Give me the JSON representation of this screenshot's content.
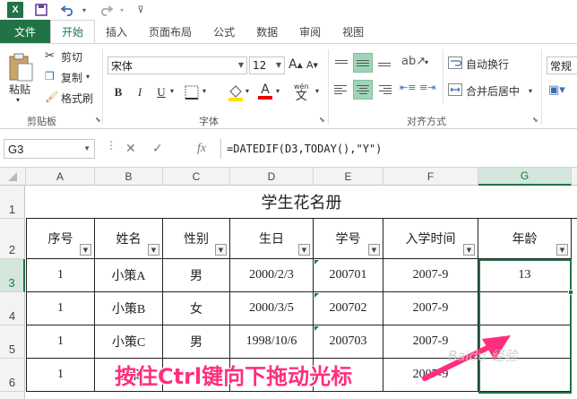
{
  "app": {
    "icon_label": "X",
    "colors": {
      "accent": "#217346",
      "select_fill": "#d3e7dc",
      "align_on": "#9fd5b7",
      "caption": "#ff2e7e",
      "arrow": "#ff2e7e"
    }
  },
  "ribbon": {
    "tabs": [
      "文件",
      "开始",
      "插入",
      "页面布局",
      "公式",
      "数据",
      "审阅",
      "视图"
    ],
    "clipboard": {
      "paste": "粘贴",
      "cut": "剪切",
      "copy": "复制",
      "format_painter": "格式刷",
      "label": "剪贴板"
    },
    "font": {
      "name": "宋体",
      "size": "12",
      "bold": "B",
      "italic": "I",
      "underline": "U",
      "wen": "wén",
      "wen_char": "文",
      "label": "字体"
    },
    "align": {
      "wrap": "自动换行",
      "merge": "合并后居中",
      "label": "对齐方式"
    },
    "number": {
      "format": "常规"
    }
  },
  "formula_bar": {
    "cell_ref": "G3",
    "fx": "fx",
    "formula": "=DATEDIF(D3,TODAY(),\"Y\")"
  },
  "grid": {
    "columns": [
      "A",
      "B",
      "C",
      "D",
      "E",
      "F",
      "G"
    ],
    "rows": [
      "1",
      "2",
      "3",
      "4",
      "5",
      "6"
    ],
    "title": "学生花名册",
    "headers": [
      "序号",
      "姓名",
      "性别",
      "生日",
      "学号",
      "入学时间",
      "年龄"
    ],
    "data": [
      [
        "1",
        "小策A",
        "男",
        "2000/2/3",
        "200701",
        "2007-9",
        "13"
      ],
      [
        "1",
        "小策B",
        "女",
        "2000/3/5",
        "200702",
        "2007-9",
        ""
      ],
      [
        "1",
        "小策C",
        "男",
        "1998/10/6",
        "200703",
        "2007-9",
        ""
      ],
      [
        "1",
        "小策",
        "",
        "",
        "",
        "2007-9",
        ""
      ]
    ]
  },
  "annotation": {
    "caption": "按住Ctrl键向下拖动光标",
    "watermark": "Baidu 经验"
  }
}
